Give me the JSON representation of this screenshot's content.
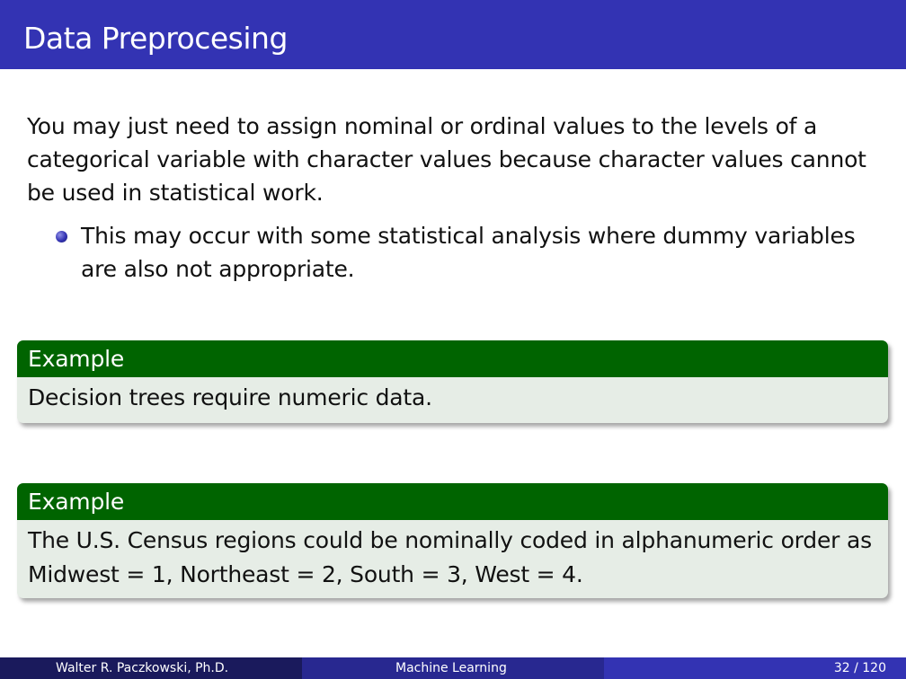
{
  "slide": {
    "title": "Data Preprocesing",
    "paragraph": "You may just need to assign nominal or ordinal values to the levels of a categorical variable with character values because character values cannot be used in statistical work.",
    "bullets": [
      "This may occur with some statistical analysis where dummy variables are also not appropriate."
    ]
  },
  "blocks": [
    {
      "heading": "Example",
      "body": "Decision trees require numeric data."
    },
    {
      "heading": "Example",
      "body": "The U.S. Census regions could be nominally coded in alphanumeric order as Midwest = 1, Northeast = 2, South = 3, West = 4."
    }
  ],
  "footer": {
    "author": "Walter R. Paczkowski, Ph.D.",
    "course": "Machine Learning",
    "page": "32 / 120"
  },
  "colors": {
    "title_bar": "#3333b3",
    "block_header": "#006400",
    "block_body": "#e6ede6",
    "footer_left": "#1a1a5c",
    "footer_mid": "#282890",
    "footer_right": "#3333b3"
  },
  "icons": {
    "bullet": "ball-bullet-icon"
  }
}
